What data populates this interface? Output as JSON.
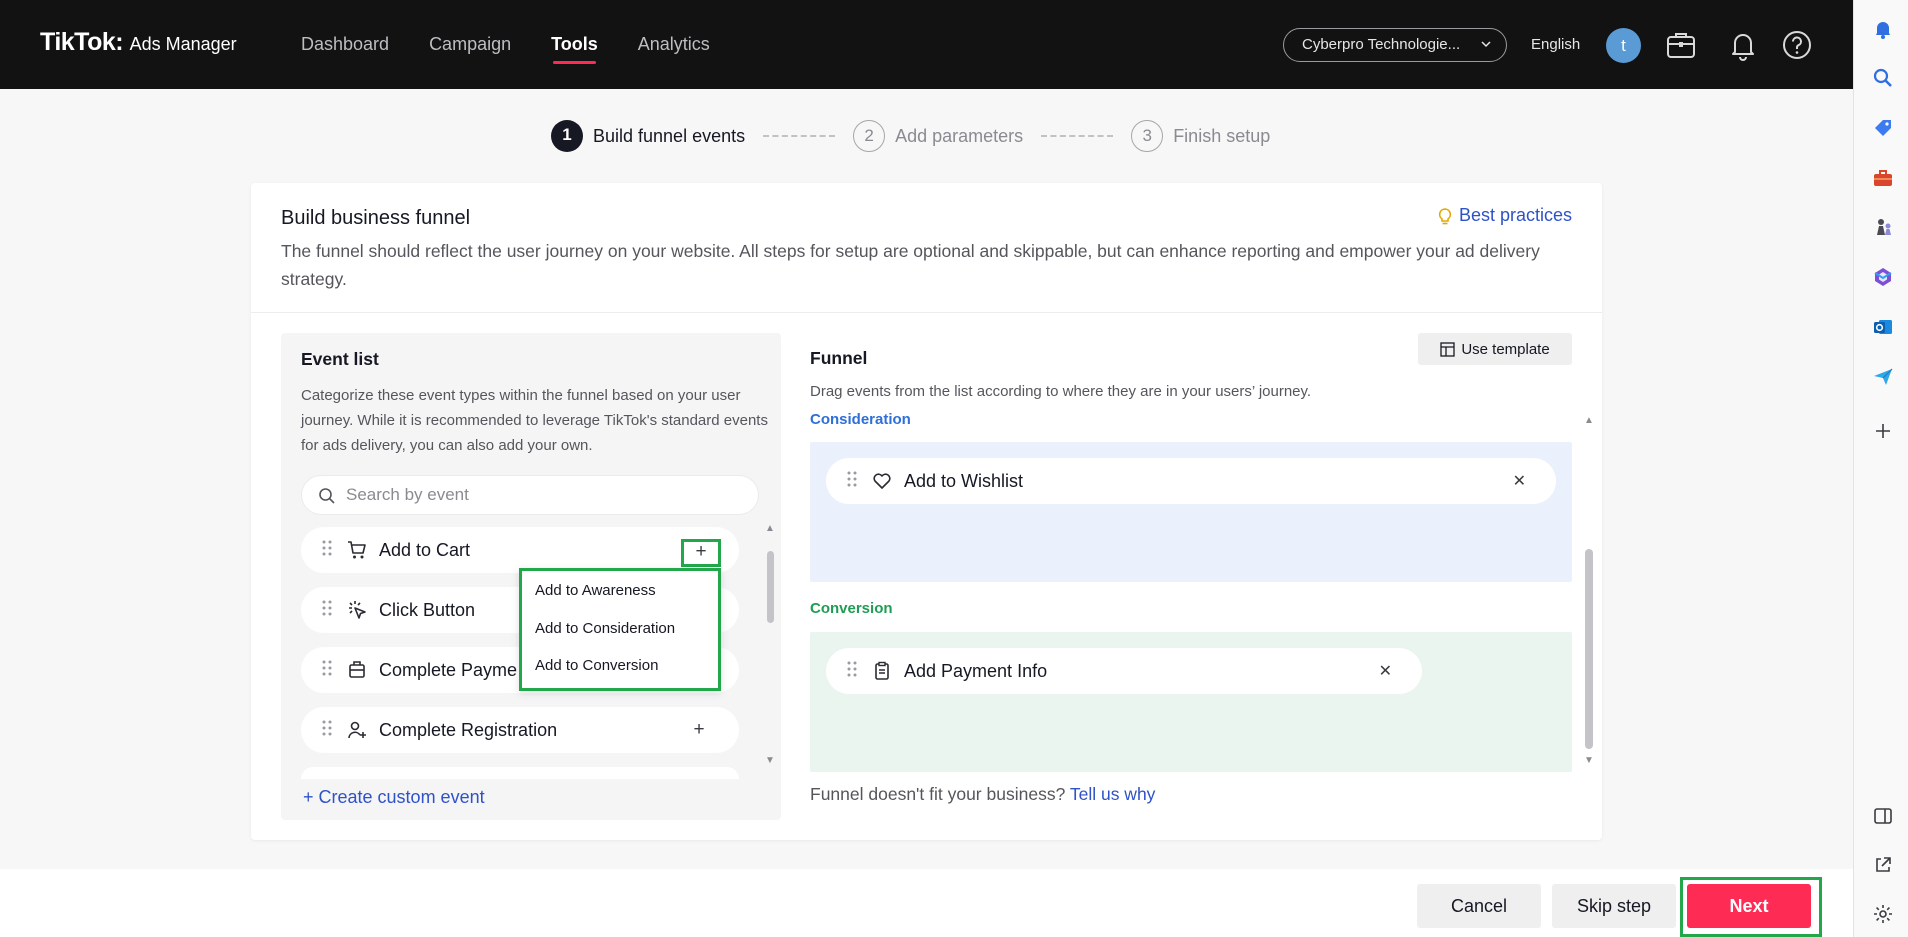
{
  "topbar": {
    "brand": "TikTok",
    "brand_sub": "Ads Manager",
    "nav": [
      "Dashboard",
      "Campaign",
      "Tools",
      "Analytics"
    ],
    "active_nav": "Tools",
    "account": "Cyberpro Technologie...",
    "language": "English",
    "avatar_letter": "t"
  },
  "stepper": {
    "steps": [
      {
        "num": "1",
        "label": "Build funnel events"
      },
      {
        "num": "2",
        "label": "Add parameters"
      },
      {
        "num": "3",
        "label": "Finish setup"
      }
    ]
  },
  "card": {
    "title": "Build business funnel",
    "best_practices": "Best practices",
    "description": "The funnel should reflect the user journey on your website. All steps for setup are optional and skippable, but can enhance reporting and empower your ad delivery strategy."
  },
  "event_list": {
    "title": "Event list",
    "description": "Categorize these event types within the funnel based on your user journey. While it is recommended to leverage TikTok's standard events for ads delivery, you can also add your own.",
    "search_placeholder": "Search by event",
    "items": [
      {
        "label": "Add to Cart",
        "icon": "cart-icon"
      },
      {
        "label": "Click Button",
        "icon": "click-icon"
      },
      {
        "label": "Complete Payme",
        "icon": "wallet-icon"
      },
      {
        "label": "Complete Registration",
        "icon": "user-add-icon"
      }
    ],
    "create_custom": "Create custom event"
  },
  "dropdown": {
    "items": [
      "Add to Awareness",
      "Add to Consideration",
      "Add to Conversion"
    ]
  },
  "funnel": {
    "title": "Funnel",
    "use_template": "Use template",
    "description": "Drag events from the list according to where they are in your users’ journey.",
    "consideration_label": "Consideration",
    "consideration_items": [
      "Add to Wishlist"
    ],
    "conversion_label": "Conversion",
    "conversion_items": [
      "Add Payment Info"
    ],
    "fit_text": "Funnel doesn't fit your business?",
    "fit_link": "Tell us why"
  },
  "footer": {
    "cancel": "Cancel",
    "skip": "Skip step",
    "next": "Next"
  },
  "colors": {
    "accent_pink": "#fe2c55",
    "link_blue": "#2e52c8",
    "highlight_green": "#22a84b",
    "consideration_bg": "#ebf1fc",
    "conversion_bg": "#e9f5ee"
  }
}
